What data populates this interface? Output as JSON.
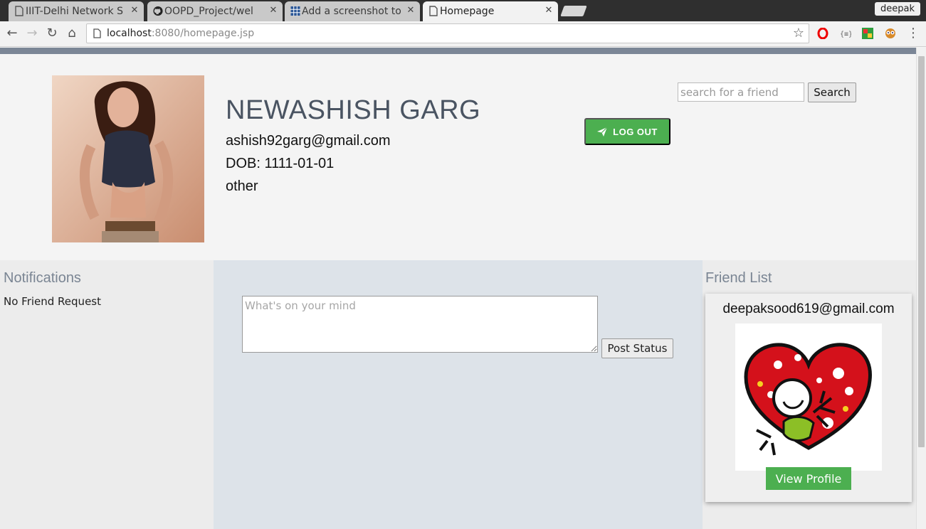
{
  "browser": {
    "tabs": [
      {
        "title": "IIIT-Delhi Network S",
        "icon": "page-icon"
      },
      {
        "title": "OOPD_Project/wel",
        "icon": "github-icon"
      },
      {
        "title": "Add a screenshot to",
        "icon": "grid-icon"
      },
      {
        "title": "Homepage",
        "icon": "page-icon",
        "active": true
      }
    ],
    "profile": "deepak",
    "url_host": "localhost",
    "url_rest": ":8080/homepage.jsp"
  },
  "profile": {
    "name": "NEWASHISH GARG",
    "email": "ashish92garg@gmail.com",
    "dob": "DOB: 1111-01-01",
    "gender": "other"
  },
  "header": {
    "logout_label": "LOG OUT",
    "search_placeholder": "search for a friend",
    "search_label": "Search"
  },
  "notifications": {
    "heading": "Notifications",
    "empty_text": "No Friend Request"
  },
  "status": {
    "placeholder": "What's on your mind",
    "post_label": "Post Status"
  },
  "friends": {
    "heading": "Friend List",
    "items": [
      {
        "email": "deepaksood619@gmail.com",
        "button_label": "View Profile"
      }
    ]
  },
  "colors": {
    "accent_green": "#4caf50",
    "heading_gray": "#7a8593",
    "name_color": "#4a5462",
    "topbar": "#7b8696",
    "center_panel": "#dde3e9"
  }
}
